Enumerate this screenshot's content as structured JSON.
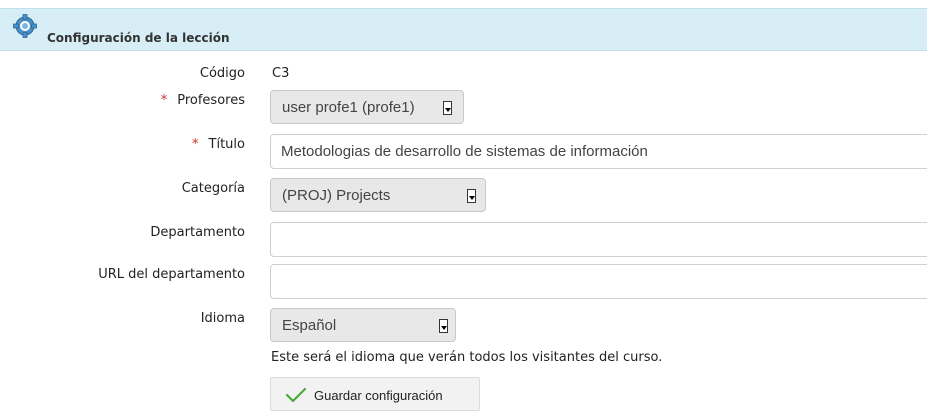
{
  "header": {
    "title": "Configuración de la lección",
    "icon": "gear-icon"
  },
  "form": {
    "codigo": {
      "label": "Código",
      "value": "C3"
    },
    "profesores": {
      "label": "Profesores",
      "required": "*",
      "selected": "user profe1 (profe1)"
    },
    "titulo": {
      "label": "Título",
      "required": "*",
      "value": "Metodologias de desarrollo de sistemas de información"
    },
    "categoria": {
      "label": "Categoría",
      "selected": "(PROJ) Projects"
    },
    "departamento": {
      "label": "Departamento",
      "value": ""
    },
    "url_departamento": {
      "label": "URL del departamento",
      "value": ""
    },
    "idioma": {
      "label": "Idioma",
      "selected": "Español",
      "help": "Este será el idioma que verán todos los visitantes del curso."
    }
  },
  "actions": {
    "save_label": "Guardar configuración",
    "save_icon": "check-icon"
  },
  "colors": {
    "header_bg": "#d7eef7",
    "required": "#d03030",
    "check": "#4caa3a"
  }
}
